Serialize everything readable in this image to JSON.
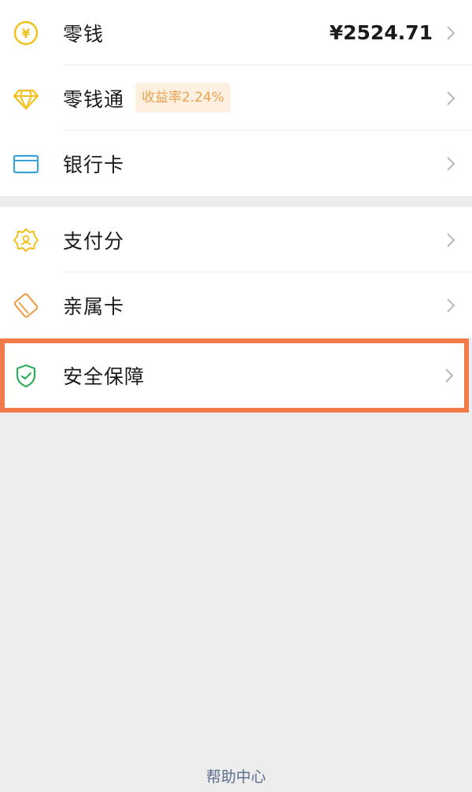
{
  "wallet": {
    "items": [
      {
        "label": "零钱",
        "value": "¥2524.71",
        "icon": "yuan-coin-icon",
        "color": "#f2c01b"
      },
      {
        "label": "零钱通",
        "badge": "收益率2.24%",
        "icon": "diamond-icon",
        "color": "#f2c01b"
      },
      {
        "label": "银行卡",
        "icon": "bank-card-icon",
        "color": "#3aa3d8"
      }
    ]
  },
  "services": {
    "items": [
      {
        "label": "支付分",
        "icon": "payscore-badge-icon",
        "color": "#f2c01b"
      },
      {
        "label": "亲属卡",
        "icon": "family-card-icon",
        "color": "#f0a04b"
      }
    ]
  },
  "security": {
    "label": "安全保障",
    "icon": "shield-check-icon",
    "color": "#2fae5e",
    "highlight_color": "#f07a4a"
  },
  "footer": {
    "help_link": "帮助中心"
  }
}
